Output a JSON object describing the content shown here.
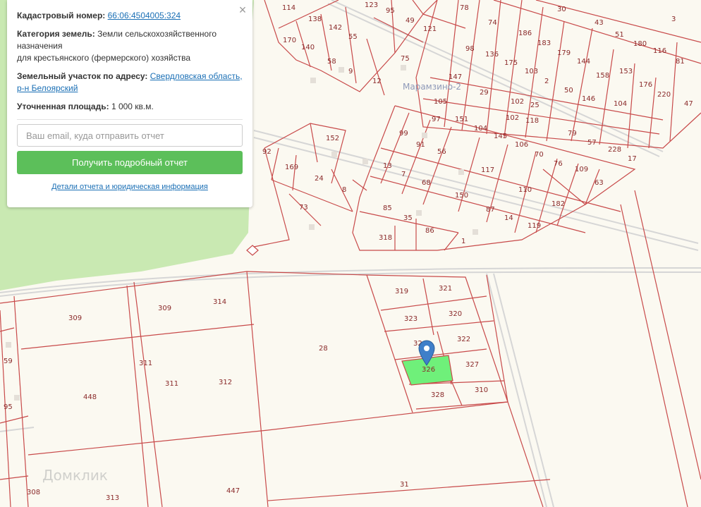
{
  "card": {
    "cadastral_label": "Кадастровый номер:",
    "cadastral_value": "66:06:4504005:324",
    "category_label": "Категория земель:",
    "category_value_line1": "Земли сельскохозяйственного",
    "category_value_line2": "назначения",
    "category_value_line3": "для крестьянского (фермерского) хозяйства",
    "address_label": "Земельный участок по адресу:",
    "address_value_line1": "Свердловская область,",
    "address_value_line2": "р-н Белоярский",
    "area_label": "Уточненная площадь:",
    "area_value": "1 000 кв.м.",
    "email_placeholder": "Ваш email, куда отправить отчет",
    "button_label": "Получить подробный отчет",
    "details_link": "Детали отчета и юридическая информация",
    "close_glyph": "×"
  },
  "map": {
    "place_name": "Марамзино-2",
    "brand": "Домклик",
    "highlight_color": "#6ff07a",
    "boundary_color": "#c84a4a",
    "marker_color": "#3f7fc9",
    "parcel_labels": [
      "114",
      "138",
      "142",
      "55",
      "170",
      "140",
      "58",
      "9",
      "12",
      "75",
      "123",
      "95",
      "49",
      "121",
      "78",
      "74",
      "186",
      "183",
      "179",
      "144",
      "30",
      "43",
      "51",
      "180",
      "116",
      "3",
      "81",
      "147",
      "98",
      "136",
      "175",
      "103",
      "2",
      "50",
      "146",
      "158",
      "153",
      "176",
      "220",
      "47",
      "29",
      "105",
      "97",
      "151",
      "104",
      "102",
      "25",
      "104",
      "102",
      "118",
      "99",
      "91",
      "56",
      "145",
      "106",
      "70",
      "76",
      "79",
      "57",
      "228",
      "17",
      "63",
      "109",
      "152",
      "92",
      "169",
      "24",
      "8",
      "13",
      "7",
      "68",
      "117",
      "150",
      "110",
      "182",
      "87",
      "14",
      "119",
      "73",
      "85",
      "35",
      "86",
      "1",
      "318",
      "319",
      "321",
      "320",
      "323",
      "322",
      "324",
      "326",
      "327",
      "328",
      "310",
      "309",
      "309",
      "314",
      "311",
      "311",
      "312",
      "448",
      "28",
      "59",
      "95",
      "308",
      "313",
      "447",
      "31"
    ]
  }
}
